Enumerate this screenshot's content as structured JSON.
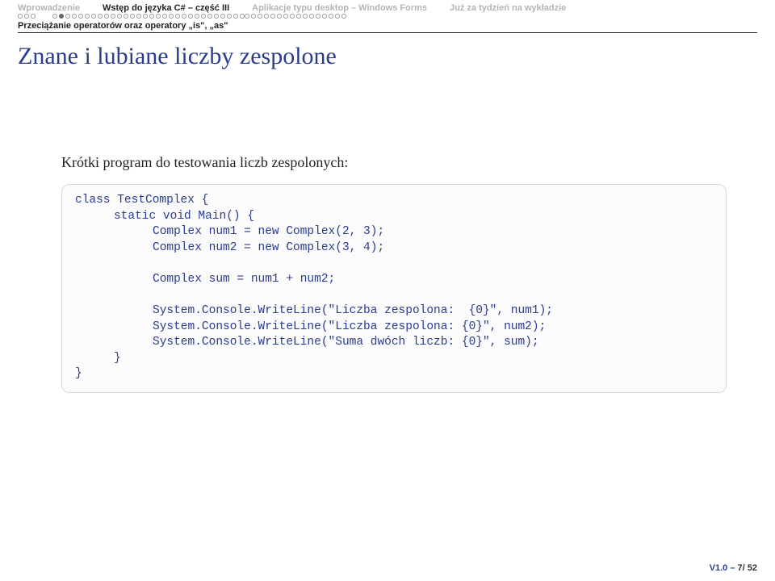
{
  "nav": {
    "items": [
      {
        "label": "Wprowadzenie",
        "active": false
      },
      {
        "label": "Wstęp do języka C# – część III",
        "active": true
      },
      {
        "label": "Aplikacje typu desktop – Windows Forms",
        "active": false
      },
      {
        "label": "Już za tydzień na wykładzie",
        "active": false
      }
    ]
  },
  "subsection": "Przeciążanie operatorów oraz operatory „is\", „as\"",
  "title": "Znane i lubiane liczby zespolone",
  "subtitle": "Krótki program do testowania liczb zespolonych:",
  "code": {
    "l1": "class TestComplex {",
    "l2": "static void Main() {",
    "l3": "Complex num1 = new Complex(2, 3);",
    "l4": "Complex num2 = new Complex(3, 4);",
    "l5": "Complex sum = num1 + num2;",
    "l6": "System.Console.WriteLine(\"Liczba zespolona:  {0}\", num1);",
    "l7": "System.Console.WriteLine(\"Liczba zespolona: {0}\", num2);",
    "l8": "System.Console.WriteLine(\"Suma dwóch liczb: {0}\", sum);",
    "l9": "}",
    "l10": "}"
  },
  "footer": {
    "version": "V1.0 – ",
    "page": "7/ 52"
  },
  "dots": {
    "group1_count": 3,
    "group2_count": 30,
    "group2_filled_index": 1,
    "group3_count": 16,
    "group4_count": 0
  }
}
